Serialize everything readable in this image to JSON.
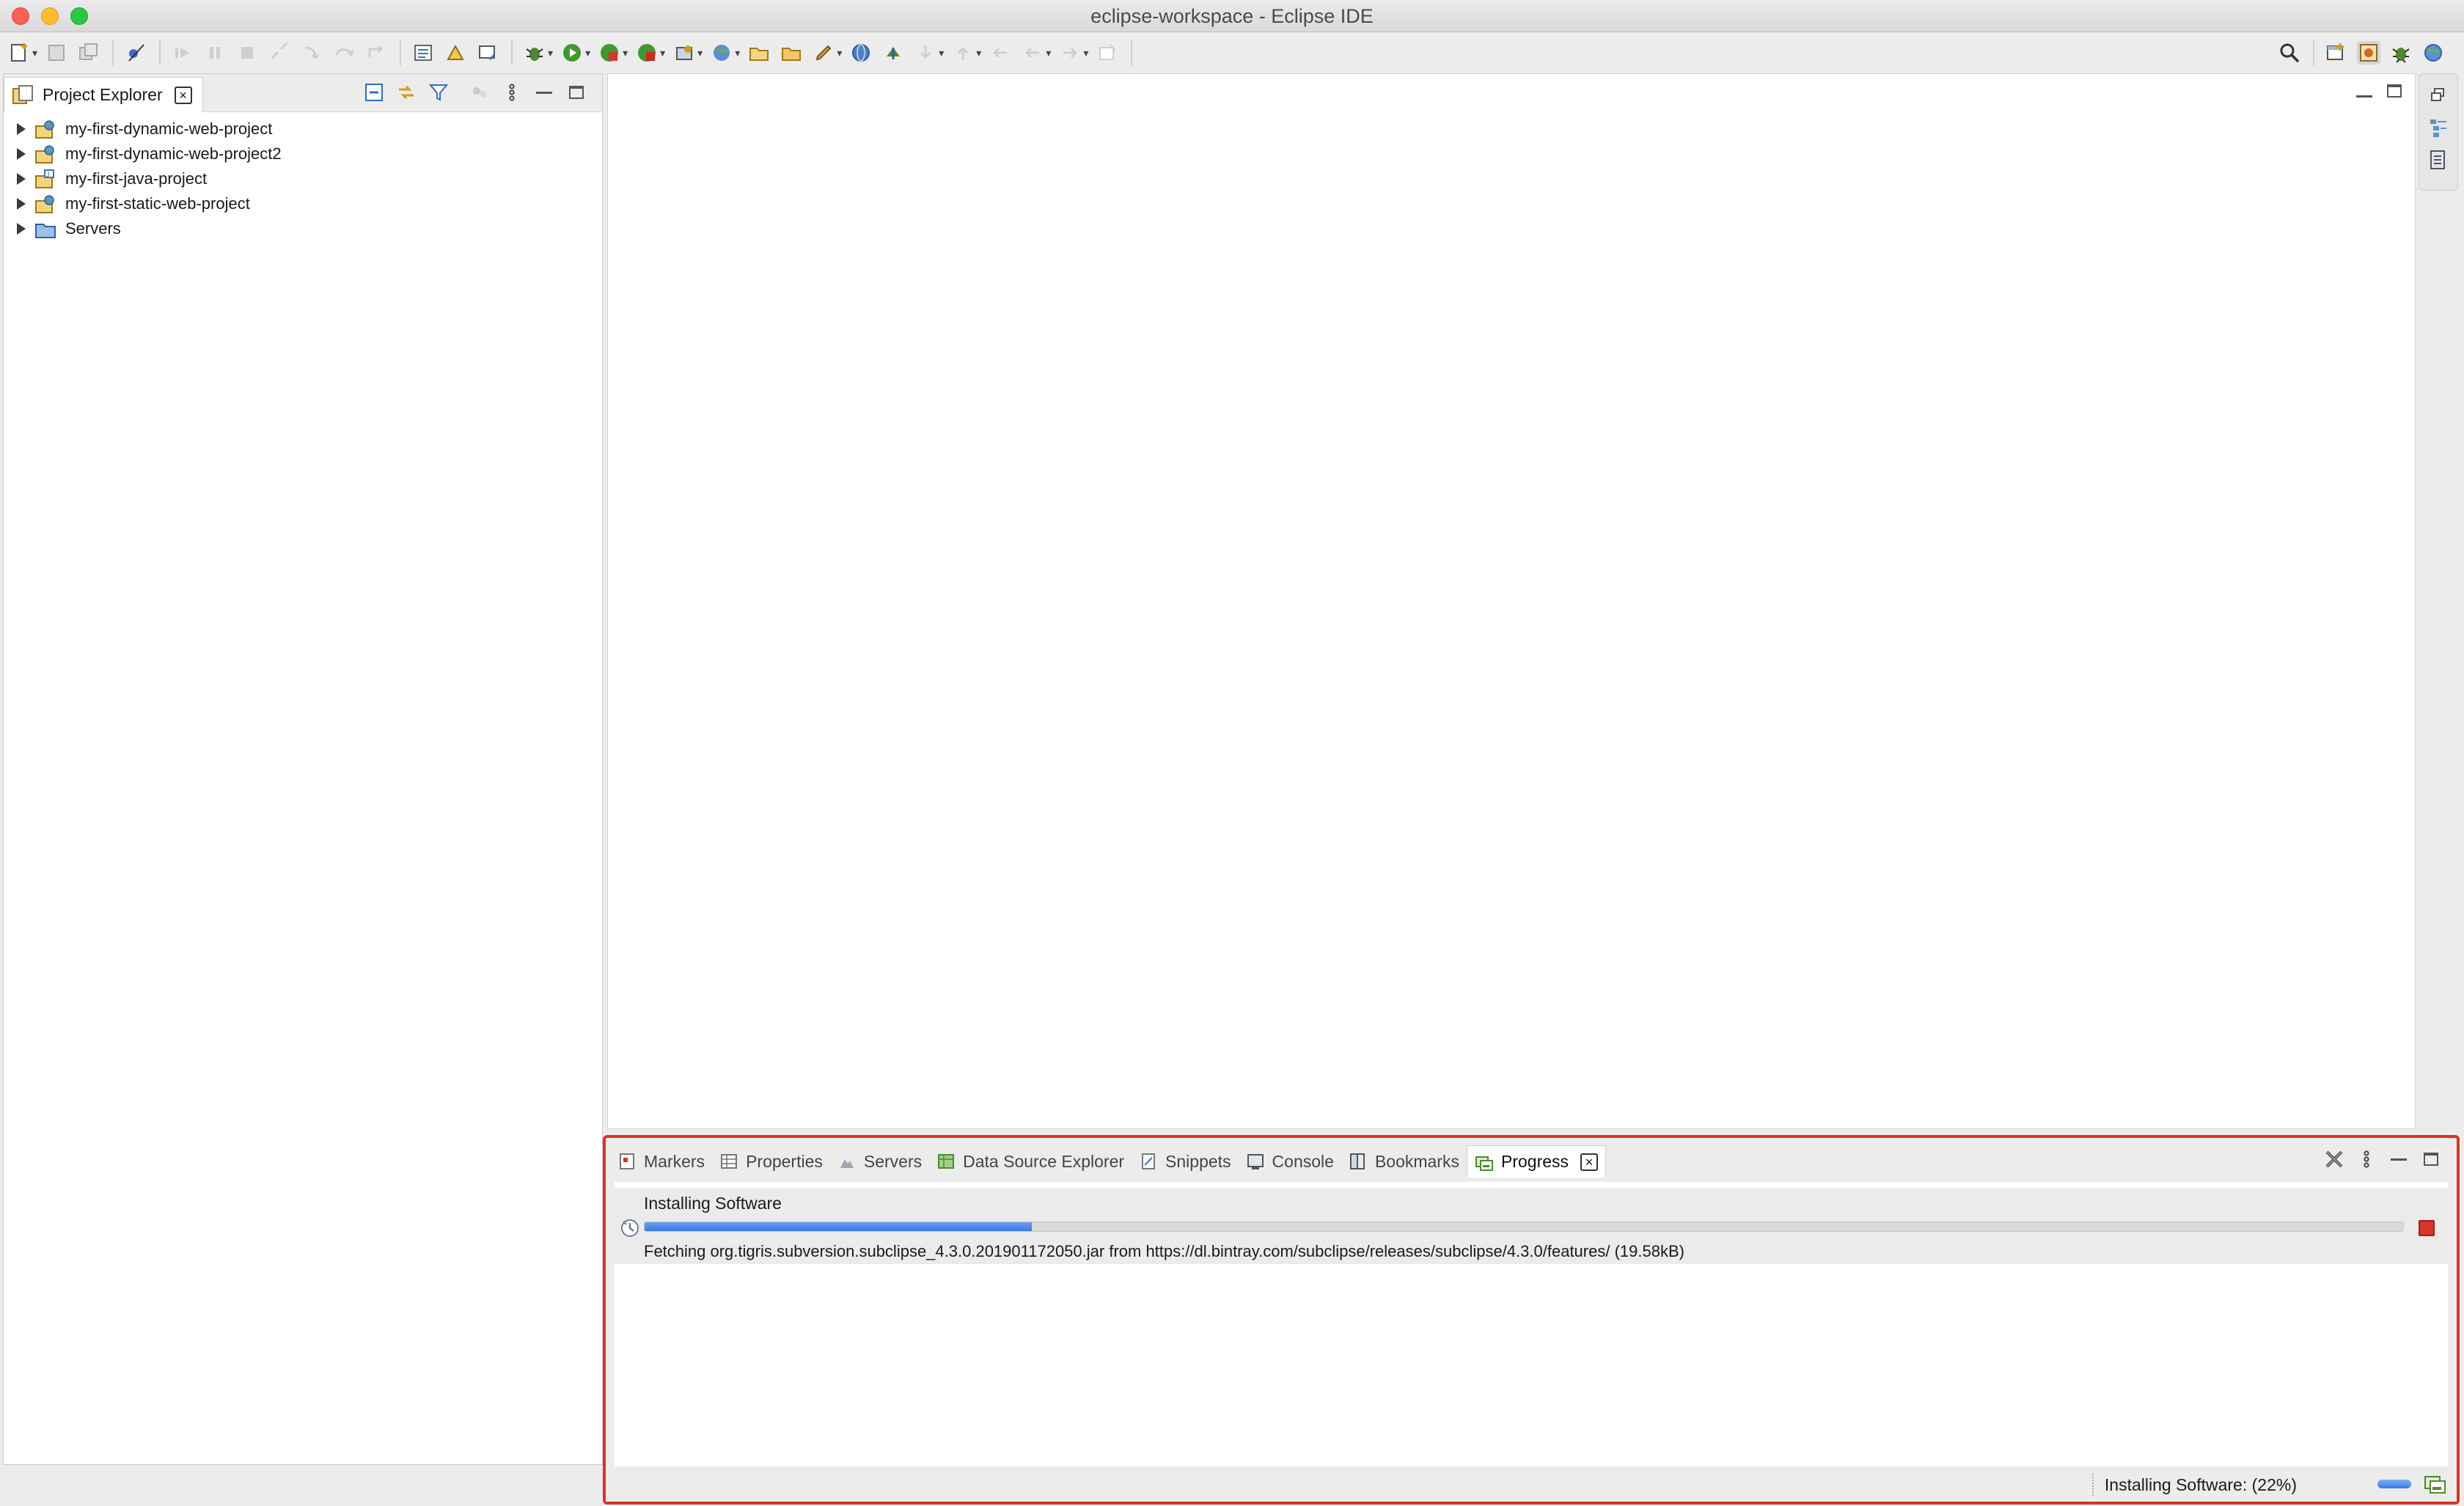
{
  "window": {
    "title": "eclipse-workspace - Eclipse IDE"
  },
  "toolbar": {
    "items": [
      "new-icon",
      "save-icon",
      "save-all-icon",
      "skip-breakpoints-icon",
      "resume-icon",
      "suspend-icon",
      "terminate-icon",
      "disconnect-icon",
      "step-into-icon",
      "step-over-icon",
      "step-return-icon",
      "open-task-icon",
      "open-type-icon",
      "open-perspective-icon",
      "debug-icon",
      "run-icon",
      "coverage-icon",
      "external-tools-icon",
      "new-server-icon",
      "new-web-icon",
      "open-folder-icon",
      "open-file-icon",
      "edit-icon",
      "globe-icon",
      "deploy-icon",
      "next-annotation-icon",
      "previous-annotation-icon",
      "back-icon",
      "back-arrow-icon",
      "forward-arrow-icon",
      "pin-icon"
    ],
    "search_icon": "search-icon",
    "perspectives": [
      "open-perspective-icon",
      "java-ee-perspective-icon",
      "debug-perspective-icon",
      "web-perspective-icon"
    ]
  },
  "project_explorer": {
    "tab_label": "Project Explorer",
    "projects": [
      {
        "name": "my-first-dynamic-web-project",
        "type": "web"
      },
      {
        "name": "my-first-dynamic-web-project2",
        "type": "web"
      },
      {
        "name": "my-first-java-project",
        "type": "java"
      },
      {
        "name": "my-first-static-web-project",
        "type": "web"
      },
      {
        "name": "Servers",
        "type": "folder"
      }
    ]
  },
  "bottom_panel": {
    "tabs": [
      {
        "label": "Markers",
        "icon": "markers-icon",
        "active": false
      },
      {
        "label": "Properties",
        "icon": "properties-icon",
        "active": false
      },
      {
        "label": "Servers",
        "icon": "servers-icon",
        "active": false
      },
      {
        "label": "Data Source Explorer",
        "icon": "data-source-icon",
        "active": false
      },
      {
        "label": "Snippets",
        "icon": "snippets-icon",
        "active": false
      },
      {
        "label": "Console",
        "icon": "console-icon",
        "active": false
      },
      {
        "label": "Bookmarks",
        "icon": "bookmarks-icon",
        "active": false
      },
      {
        "label": "Progress",
        "icon": "progress-icon",
        "active": true
      }
    ],
    "job": {
      "name": "Installing Software",
      "progress": 0.22,
      "detail": "Fetching org.tigris.subversion.subclipse_4.3.0.201901172050.jar from https://dl.bintray.com/subclipse/releases/subclipse/4.3.0/features/ (19.58kB)"
    }
  },
  "status_bar": {
    "text": "Installing Software: (22%)"
  },
  "colors": {
    "accent": "#3a78e0",
    "highlight_border": "#e0321f",
    "stop": "#d9342b"
  }
}
